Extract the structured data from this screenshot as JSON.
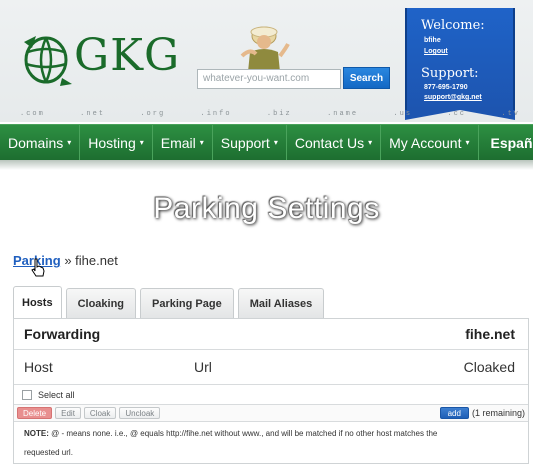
{
  "header": {
    "logo_text": "GKG",
    "search_placeholder": "whatever-you-want.com",
    "search_button": "Search",
    "tlds": [
      ".com",
      ".net",
      ".org",
      ".info",
      ".biz",
      ".name",
      ".us",
      ".cc",
      ".tv"
    ],
    "welcome_title": "Welcome:",
    "username": "bfihe",
    "logout": "Logout",
    "support_title": "Support:",
    "support_phone": "877-695-1790",
    "support_email": "support@gkg.net"
  },
  "nav": {
    "items": [
      "Domains",
      "Hosting",
      "Email",
      "Support",
      "Contact Us",
      "My Account"
    ],
    "language": "Español"
  },
  "page": {
    "title": "Parking Settings",
    "breadcrumb_link": "Parking",
    "breadcrumb_sep": "»",
    "breadcrumb_current": "fihe.net"
  },
  "tabs": [
    "Hosts",
    "Cloaking",
    "Parking Page",
    "Mail Aliases"
  ],
  "panel": {
    "forwarding_label": "Forwarding",
    "domain": "fihe.net",
    "col_host": "Host",
    "col_url": "Url",
    "col_cloaked": "Cloaked",
    "select_all": "Select all",
    "actions": {
      "delete": "Delete",
      "edit": "Edit",
      "cloak": "Cloak",
      "uncloak": "Uncloak",
      "add": "add",
      "remaining": "(1 remaining)"
    },
    "note_label": "NOTE:",
    "note_line1": " @ - means none. i.e., @ equals http://fihe.net without www., and will be matched if no other host matches the",
    "note_line2": "requested url."
  },
  "colors": {
    "nav_green": "#1d6e30",
    "ribbon_blue": "#1d55b0",
    "link_blue": "#1f5fbf",
    "delete_red": "#e88f8f"
  }
}
